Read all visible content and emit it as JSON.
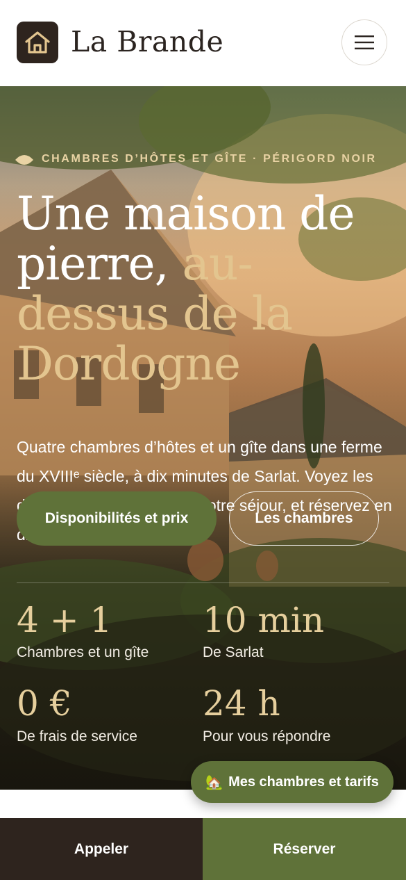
{
  "header": {
    "brand": "La Brande",
    "logo_icon": "house-icon",
    "menu_icon": "hamburger-menu-icon"
  },
  "hero": {
    "eyebrow": "CHAMBRES D’HÔTES ET GÎTE · PÉRIGORD NOIR",
    "title_part1": "Une maison de pierre, ",
    "title_accent": "au-dessus de la Dordogne",
    "lead": "Quatre chambres d’hôtes et un gîte dans une ferme du XVIIIᵉ siècle, à dix minutes de Sarlat. Voyez les disponibilités et le prix de votre séjour, et réservez en direct.",
    "primary_button": "Disponibilités et prix",
    "secondary_button": "Les chambres",
    "stats": [
      {
        "value": "4 + 1",
        "label": "Chambres et un gîte"
      },
      {
        "value": "10 min",
        "label": "De Sarlat"
      },
      {
        "value": "0 €",
        "label": "De frais de service"
      },
      {
        "value": "24 h",
        "label": "Pour vous répondre"
      }
    ]
  },
  "floating_button": {
    "emoji": "🏡",
    "label": "Mes chambres et tarifs"
  },
  "bottom_bar": {
    "call_label": "Appeler",
    "book_label": "Réserver"
  },
  "colors": {
    "dark": "#2e241e",
    "olive": "#5f7239",
    "gold": "#e3c58f"
  }
}
